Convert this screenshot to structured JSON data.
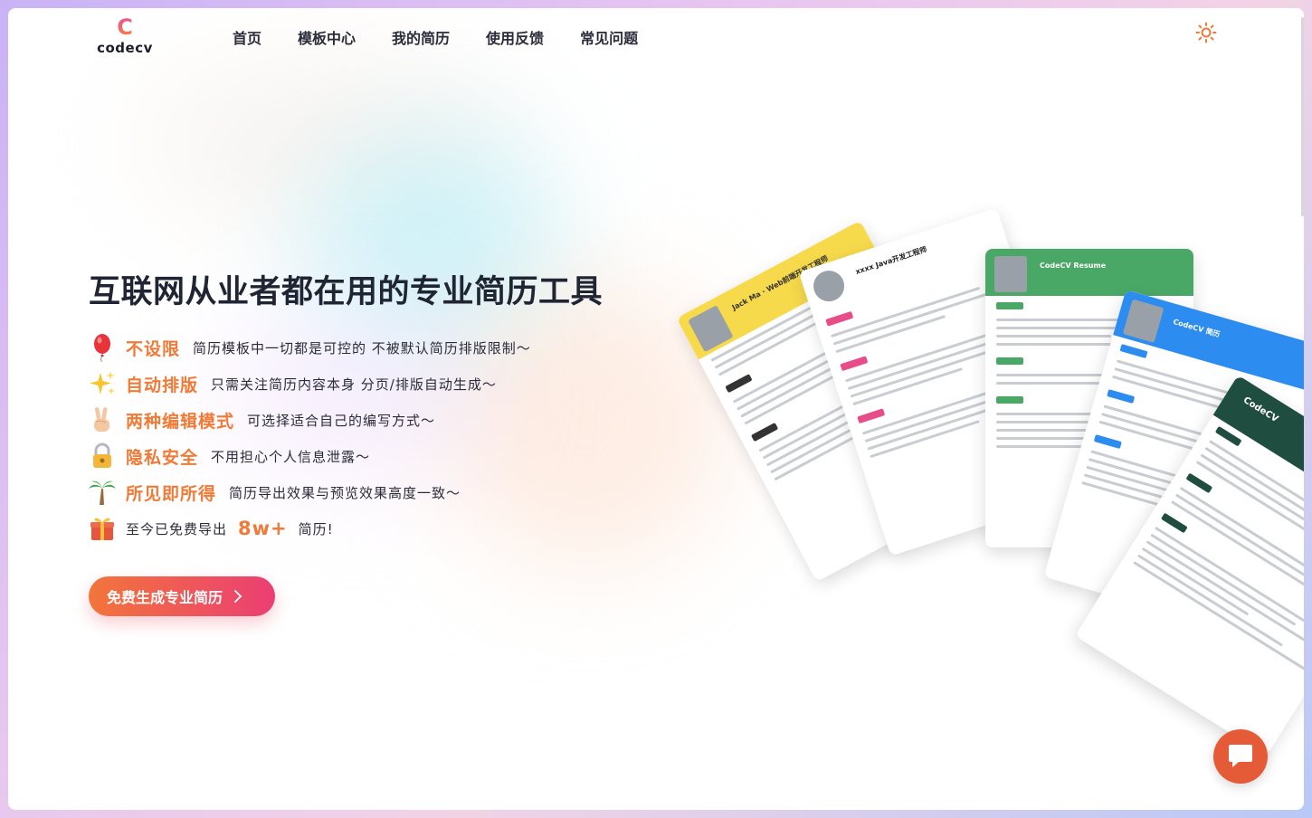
{
  "brand": {
    "logo_mark": "C",
    "logo_text": "codecv"
  },
  "nav": [
    {
      "label": "首页"
    },
    {
      "label": "模板中心"
    },
    {
      "label": "我的简历"
    },
    {
      "label": "使用反馈"
    },
    {
      "label": "常见问题"
    }
  ],
  "header": {
    "theme_icon": "sun-icon"
  },
  "hero": {
    "title": "互联网从业者都在用的专业简历工具",
    "features": [
      {
        "icon": "balloon-icon",
        "title": "不设限",
        "desc": "简历模板中一切都是可控的 不被默认简历排版限制～"
      },
      {
        "icon": "sparkles-icon",
        "title": "自动排版",
        "desc": "只需关注简历内容本身 分页/排版自动生成～"
      },
      {
        "icon": "victory-hand-icon",
        "title": "两种编辑模式",
        "desc": "可选择适合自己的编写方式～"
      },
      {
        "icon": "lock-icon",
        "title": "隐私安全",
        "desc": "不用担心个人信息泄露～"
      },
      {
        "icon": "palm-tree-icon",
        "title": "所见即所得",
        "desc": "简历导出效果与预览效果高度一致～"
      }
    ],
    "export_stat": {
      "icon": "gift-icon",
      "prefix": "至今已免费导出",
      "count": "8w+",
      "suffix": "简历!"
    },
    "cta_label": "免费生成专业简历"
  },
  "resume_previews": [
    {
      "header_color": "#f7d94c",
      "title": "Jack Ma · Web前端开发工程师"
    },
    {
      "header_color": "#ffffff",
      "title": "xxxx Java开发工程师"
    },
    {
      "header_color": "#4aa866",
      "title": "CodeCV Resume"
    },
    {
      "header_color": "#2d8cf0",
      "title": "CodeCV 简历"
    },
    {
      "header_color": "#1f4d3f",
      "title": "CodeCV"
    }
  ],
  "colors": {
    "accent": "#f07a36",
    "cta_start": "#f2753a",
    "cta_end": "#eb3e74",
    "chat": "#e55a37"
  },
  "chat": {
    "icon": "chat-icon"
  }
}
